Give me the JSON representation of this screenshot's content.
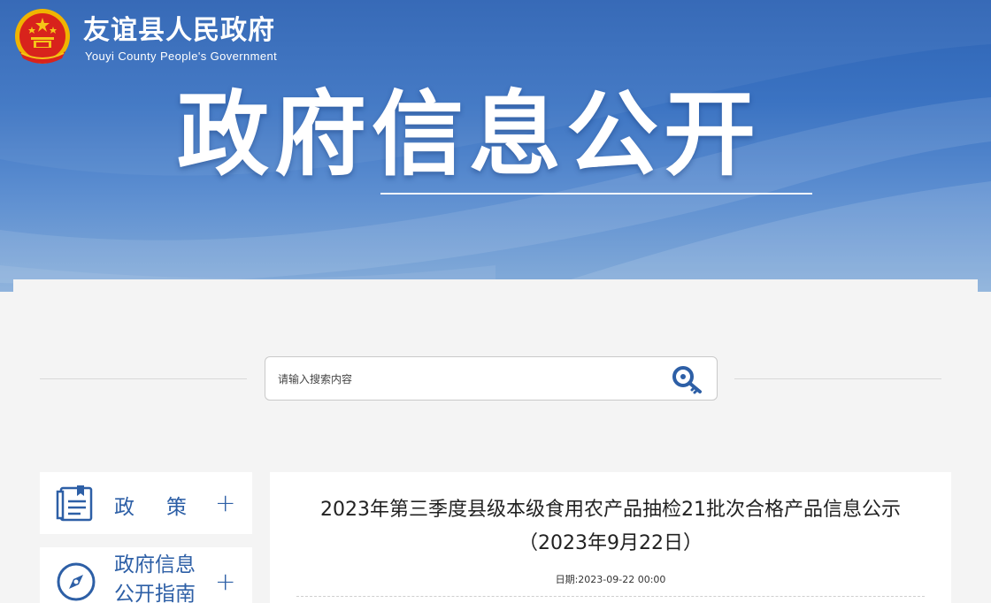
{
  "header": {
    "site_title": "友谊县人民政府",
    "site_subtitle": "Youyi County People's Government",
    "hero_title": "政府信息公开"
  },
  "search": {
    "placeholder": "请输入搜索内容",
    "value": ""
  },
  "sidebar": {
    "items": [
      {
        "label": "政策",
        "icon": "document-icon",
        "action": "+"
      },
      {
        "label": "政府信息公开指南",
        "icon": "compass-icon",
        "action": "+"
      }
    ]
  },
  "article": {
    "title": "2023年第三季度县级本级食用农产品抽检21批次合格产品信息公示",
    "subtitle": "（2023年9月22日）",
    "date_label": "日期:",
    "date_value": "2023-09-22 00:00"
  },
  "colors": {
    "banner_blue": "#2d63b4",
    "accent_blue": "#2d5fa6",
    "emblem_red": "#d8231c",
    "emblem_gold": "#f5c518"
  }
}
